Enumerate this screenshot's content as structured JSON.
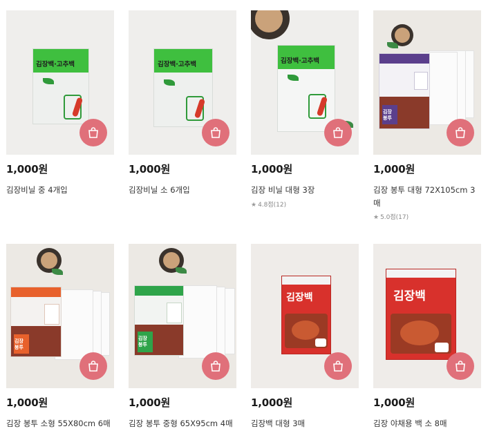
{
  "cart_icon": "shopping-bag-icon",
  "products": [
    {
      "price": "1,000원",
      "title": "김장비닐 중 4개입",
      "rating": "",
      "pkg_label": "김장백·고추백"
    },
    {
      "price": "1,000원",
      "title": "김장비닐 소 6개입",
      "rating": "",
      "pkg_label": "김장백·고추백"
    },
    {
      "price": "1,000원",
      "title": "김장 비닐 대형 3장",
      "rating": "4.8점(12)",
      "pkg_label": "김장백·고추백"
    },
    {
      "price": "1,000원",
      "title": "김장 봉투 대형 72X105cm 3매",
      "rating": "5.0점(17)",
      "pkg_label": "김장 봉투"
    },
    {
      "price": "1,000원",
      "title": "김장 봉투 소형 55X80cm 6매",
      "rating": "",
      "pkg_label": "김장 봉투"
    },
    {
      "price": "1,000원",
      "title": "김장 봉투 중형 65X95cm 4매",
      "rating": "",
      "pkg_label": "김장 봉투"
    },
    {
      "price": "1,000원",
      "title": "김장백 대형 3매",
      "rating": "",
      "pkg_label": "김장백"
    },
    {
      "price": "1,000원",
      "title": "김장 야채용 백 소 8매",
      "rating": "",
      "pkg_label": "김장백"
    }
  ],
  "colors": {
    "cart_button": "#e0707a",
    "green_pack": "#3fbf3f",
    "purple_pack": "#5b3f8c",
    "orange_pack": "#e8612c",
    "red_pack": "#d8312c"
  }
}
